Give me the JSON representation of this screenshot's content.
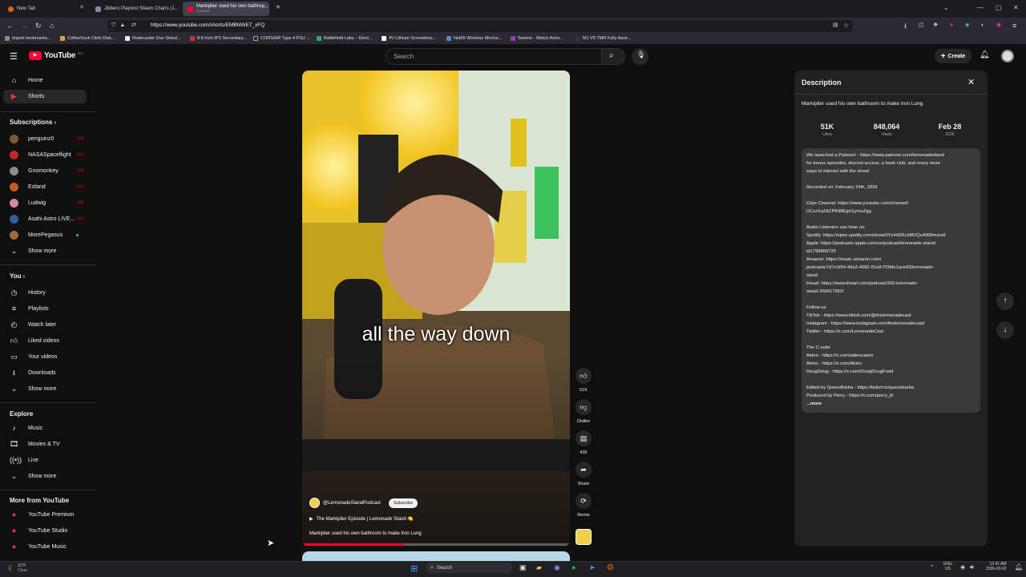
{
  "browser": {
    "tabs": [
      {
        "title": "New Tab",
        "active": false
      },
      {
        "title": "Jibbers Playtest Steam Charts (J...",
        "active": false
      },
      {
        "title": "Markiplier used his own bathroo...",
        "subtitle": "PLAYING",
        "active": true
      }
    ],
    "url": "https://www.youtube.com/shorts/EMBNWE7_xFQ",
    "bookmarks": [
      "Import bookmarks...",
      "CoffeeSock Cloth Disk...",
      "Rodecaster Duo Stand...",
      "8.8 Inch IPS Secondary...",
      "CORSAIR Type 4 PSU ...",
      "Battlefield Labs – Elect...",
      "4V Lithium Screwdrive...",
      "Nut65 Wireless Mecha...",
      "9anime - Watch Anim...",
      "M1 V5 TMR Fully Asse..."
    ]
  },
  "youtube": {
    "logo_text": "YouTube",
    "region": "CA",
    "search_placeholder": "Search",
    "create_label": "Create"
  },
  "sidebar": {
    "main": [
      {
        "label": "Home",
        "icon": "home-icon"
      },
      {
        "label": "Shorts",
        "icon": "shorts-icon",
        "active": true
      }
    ],
    "subscriptions_heading": "Subscriptions",
    "subscriptions": [
      {
        "label": "penguinz0",
        "color": "#7a5a3a",
        "live": true
      },
      {
        "label": "NASASpaceflight",
        "color": "#c2262a",
        "live": true
      },
      {
        "label": "Gnomonkey",
        "color": "#8c8c8c",
        "live": true
      },
      {
        "label": "Esfand",
        "color": "#c55a1a",
        "live": true
      },
      {
        "label": "Ludwig",
        "color": "#d58aa0",
        "live": true
      },
      {
        "label": "Asahi Astro LIVE...",
        "color": "#3a5aa0",
        "live": true
      },
      {
        "label": "MorePegasus",
        "color": "#a06a3a",
        "dot": true
      }
    ],
    "subs_show_more": "Show more",
    "you_heading": "You",
    "you": [
      {
        "label": "History",
        "icon": "history-icon"
      },
      {
        "label": "Playlists",
        "icon": "playlists-icon"
      },
      {
        "label": "Watch later",
        "icon": "watch-later-icon"
      },
      {
        "label": "Liked videos",
        "icon": "liked-videos-icon"
      },
      {
        "label": "Your videos",
        "icon": "your-videos-icon"
      },
      {
        "label": "Downloads",
        "icon": "downloads-icon"
      }
    ],
    "you_show_more": "Show more",
    "explore_heading": "Explore",
    "explore": [
      {
        "label": "Music",
        "icon": "music-icon"
      },
      {
        "label": "Movies & TV",
        "icon": "movies-icon"
      },
      {
        "label": "Live",
        "icon": "live-icon"
      }
    ],
    "explore_show_more": "Show more",
    "more_heading": "More from YouTube",
    "more": [
      {
        "label": "YouTube Premium"
      },
      {
        "label": "YouTube Studio"
      },
      {
        "label": "YouTube Music"
      }
    ]
  },
  "short": {
    "caption": "all the way down",
    "channel": "@LemonadeStandPodcast",
    "subscribe_label": "Subscribe",
    "playlist": "The Markiplier Episode | Lemonade Stand 🍋",
    "title": "Markiplier used his own bathroom to make Iron Lung",
    "progress": 0.38,
    "actions": {
      "likes": "51K",
      "dislike": "Dislike",
      "comments": "435",
      "share": "Share",
      "remix": "Remix"
    }
  },
  "description": {
    "heading": "Description",
    "video_title": "Markiplier used his own bathroom to make Iron Lung",
    "stats": [
      {
        "value": "51K",
        "label": "Likes"
      },
      {
        "value": "848,064",
        "label": "Views"
      },
      {
        "value": "Feb 28",
        "label": "2026"
      }
    ],
    "lines": [
      "We launched a Patreon! - https://www.patreon.com/lemonadestand",
      "for bonus episodes, discord access, a book club, and many more",
      "ways to interact with the show!",
      "",
      "Recorded on: February 24th, 2026",
      "",
      "Clips Channel: https://www.youtube.com/channel/",
      "UCurXaZAZPKtl8EgH1ymuZgg",
      "",
      "Audio Listeners can hear us:",
      "Spotify: https://open.spotify.com/show/0Yz442Rz3t8VQu4WRmsrs6",
      "Apple: https://podcasts.apple.com/us/podcast/lemonade-stand/",
      "id1799868725",
      "Amazon: https://music.amazon.com/",
      "podcasts/7d7e1f54-49a3-4082-81e8-f70bfe1ace63/lemonade-",
      "stand",
      "iHeart: https://www.iheart.com/podcast/269-lemonade-",
      "stand-269417962/",
      "",
      "Follow us",
      "TikTok - https://www.tiktok.com/@thelemonadecast",
      "Instagram - https://www.instagram.com/thelemonadecast/",
      "Twitter - https://x.com/LemonadeCast",
      "",
      "The C-suite",
      "Aiden - https://x.com/aidencalvin",
      "Atrioc - https://x.com/Atrioc",
      "DougDoug - https://x.com/DougDougFood",
      "",
      "Edited by QuesoBarba - https://twitch.tv/quesobarba",
      "Produced by Perry - https://x.com/perry_jh"
    ],
    "more_label": "...more"
  },
  "taskbar": {
    "weather_temp": "11°F",
    "weather_text": "Clear",
    "search": "Search",
    "lang1": "ENG",
    "lang2": "US",
    "time": "12:41 AM",
    "date": "2026-03-02"
  }
}
